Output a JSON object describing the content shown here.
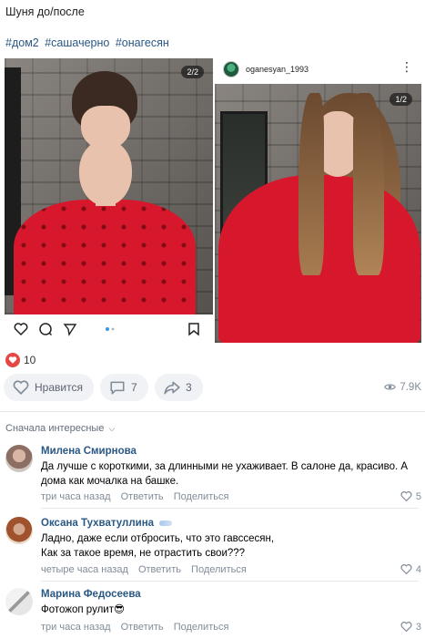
{
  "post": {
    "text": "Шуня до/после",
    "hashtags": [
      "#дом2",
      "#сашачерно",
      "#онагесян"
    ]
  },
  "left_photo": {
    "badge": "2/2"
  },
  "right_photo": {
    "username": "oganesyan_1993",
    "badge": "1/2",
    "more": "⋮"
  },
  "likes": {
    "count": "10"
  },
  "actions": {
    "like_label": "Нравится",
    "comments_count": "7",
    "shares_count": "3",
    "views": "7.9K"
  },
  "comments_sort": {
    "label": "Сначала интересные"
  },
  "comments": [
    {
      "author": "Милена Смирнова",
      "text": "Да лучше с короткими, за длинными не ухаживает. В салоне да, красиво. А дома как мочалка на башке.",
      "time": "три часа назад",
      "reply": "Ответить",
      "share": "Поделиться",
      "likes": "5"
    },
    {
      "author": "Оксана Тухватуллина",
      "text": "Ладно, даже если отбросить, что это гавссесян,\nКак за такое время, не отрастить свои???",
      "time": "четыре часа назад",
      "reply": "Ответить",
      "share": "Поделиться",
      "likes": "4"
    },
    {
      "author": "Марина Федосеева",
      "text": "Фотожоп рулит😎",
      "time": "три часа назад",
      "reply": "Ответить",
      "share": "Поделиться",
      "likes": "3"
    }
  ],
  "colors": {
    "link": "#2a5885",
    "like_red": "#e64646",
    "sweater_red": "#d7182c",
    "meta_gray": "#818c99"
  }
}
